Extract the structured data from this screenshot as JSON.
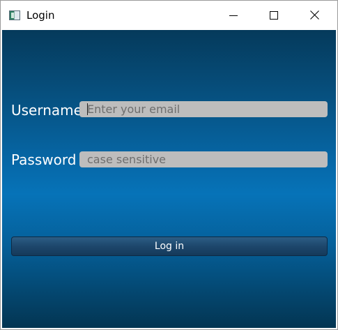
{
  "window": {
    "title": "Login",
    "controls": {
      "minimize_icon": "minimize-icon",
      "maximize_icon": "maximize-icon",
      "close_icon": "close-icon"
    }
  },
  "form": {
    "username_label": "Username",
    "username_placeholder": "Enter your email",
    "username_value": "",
    "password_label": "Password",
    "password_placeholder": "case sensitive",
    "password_value": "",
    "login_label": "Log in"
  },
  "colors": {
    "background_top": "#053a5b",
    "background_mid": "#0673b8",
    "background_bottom": "#033552",
    "field_bg": "#bdbdbd",
    "button_bg": "#1d476c",
    "label_text": "#ffffff"
  }
}
